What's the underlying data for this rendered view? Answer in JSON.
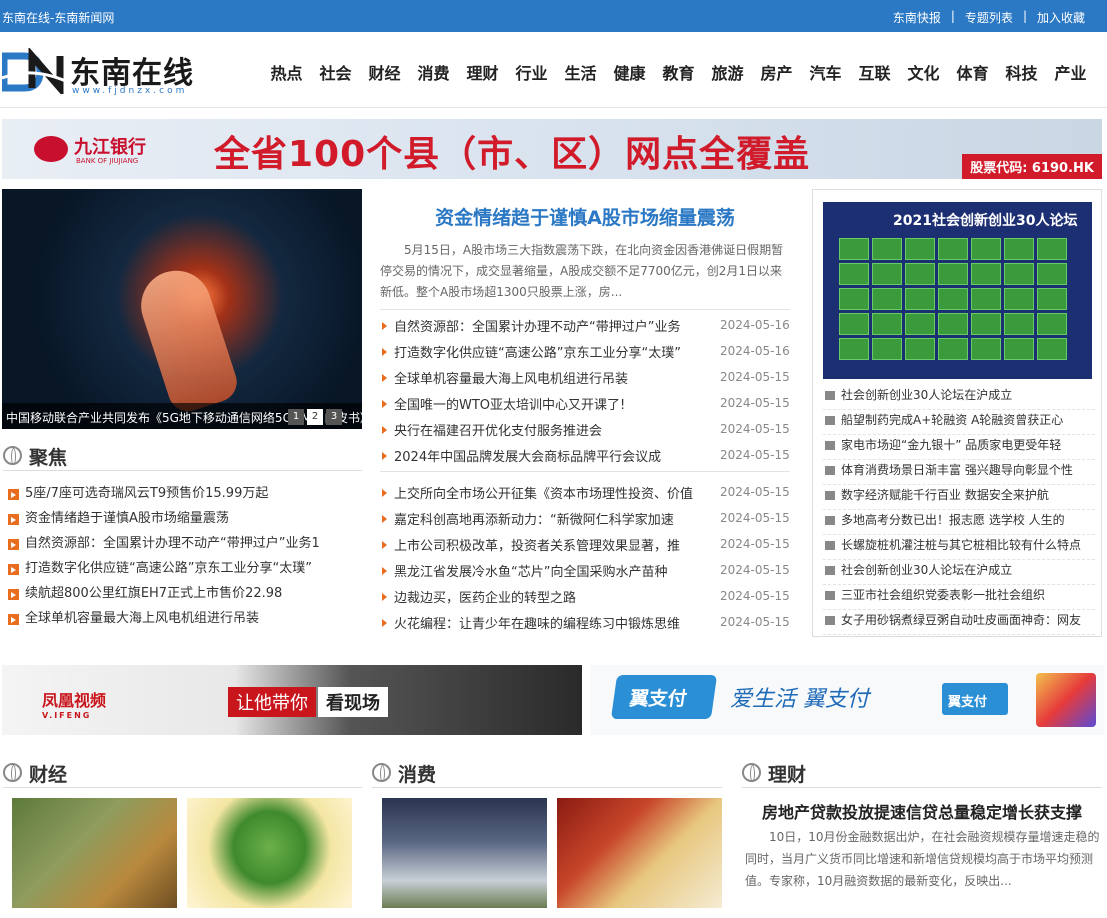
{
  "topbar": {
    "site_title": "东南在线-东南新闻网",
    "links": [
      "东南快报",
      "专题列表",
      "加入收藏"
    ]
  },
  "logo": {
    "name": "东南在线",
    "url": "www.fjdnzx.com"
  },
  "nav": [
    "热点",
    "社会",
    "财经",
    "消费",
    "理财",
    "行业",
    "生活",
    "健康",
    "教育",
    "旅游",
    "房产",
    "汽车",
    "互联",
    "文化",
    "体育",
    "科技",
    "产业"
  ],
  "banner_top": {
    "bank_cn": "九江银行",
    "bank_en": "BANK OF JIUJIANG",
    "slogan": "全省100个县（市、区）网点全覆盖",
    "stock_code": "股票代码: 6190.HK"
  },
  "hero": {
    "caption": "中国移动联合产业共同发布《5G地下移动通信网络5GDMNI白皮书》",
    "pages": [
      "1",
      "2",
      "3"
    ]
  },
  "lead": {
    "title": "资金情绪趋于谨慎A股市场缩量震荡",
    "summary": "5月15日，A股市场三大指数震荡下跌，在北向资金因香港佛诞日假期暂停交易的情况下，成交显著缩量，A股成交额不足7700亿元，创2月1日以来新低。整个A股市场超1300只股票上涨，房..."
  },
  "news_group1": [
    {
      "title": "自然资源部：全国累计办理不动产“带押过户”业务",
      "date": "2024-05-16"
    },
    {
      "title": "打造数字化供应链“高速公路”京东工业分享“太璞”",
      "date": "2024-05-16"
    },
    {
      "title": "全球单机容量最大海上风电机组进行吊装",
      "date": "2024-05-15"
    },
    {
      "title": "全国唯一的WTO亚太培训中心又开课了!",
      "date": "2024-05-15"
    },
    {
      "title": "央行在福建召开优化支付服务推进会",
      "date": "2024-05-15"
    },
    {
      "title": "2024年中国品牌发展大会商标品牌平行会议成",
      "date": "2024-05-15"
    }
  ],
  "news_group2": [
    {
      "title": "上交所向全市场公开征集《资本市场理性投资、价值",
      "date": "2024-05-15"
    },
    {
      "title": "嘉定科创高地再添新动力：“新微阿仁科学家加速",
      "date": "2024-05-15"
    },
    {
      "title": "上市公司积极改革，投资者关系管理效果显著，推",
      "date": "2024-05-15"
    },
    {
      "title": "黑龙江省发展冷水鱼“芯片”向全国采购水产苗种",
      "date": "2024-05-15"
    },
    {
      "title": "边裁边买，医药企业的转型之路",
      "date": "2024-05-15"
    },
    {
      "title": "火花编程：让青少年在趣味的编程练习中锻炼思维",
      "date": "2024-05-15"
    }
  ],
  "side": {
    "pic_title": "2021社会创新创业30人论坛",
    "items": [
      "社会创新创业30人论坛在沪成立",
      "船望制药完成A+轮融资 A轮融资曾获正心",
      "家电市场迎“金九银十” 品质家电更受年轻",
      "体育消费场景日渐丰富 强兴趣导向彰显个性",
      "数字经济赋能千行百业 数据安全来护航",
      "多地高考分数已出！报志愿 选学校 人生的",
      "长螺旋桩机灌注桩与其它桩相比较有什么特点",
      "社会创新创业30人论坛在沪成立",
      "三亚市社会组织党委表彰一批社会组织",
      "女子用砂锅煮绿豆粥自动吐皮画面神奇：网友"
    ]
  },
  "focus": {
    "label": "聚焦",
    "items": [
      "5座/7座可选奇瑞风云T9预售价15.99万起",
      "资金情绪趋于谨慎A股市场缩量震荡",
      "自然资源部：全国累计办理不动产“带押过户”业务1",
      "打造数字化供应链“高速公路”京东工业分享“太璞”",
      "续航超800公里红旗EH7正式上市售价22.98",
      "全球单机容量最大海上风电机组进行吊装"
    ]
  },
  "ad_mid": {
    "brand": "凤凰视频",
    "brand_en": "V.IFENG",
    "tag1": "让他带你",
    "tag2": "看现场",
    "pay_brand": "翼支付",
    "pay_slogan": "爱生活 翼支付",
    "pay_badge": "翼支付"
  },
  "sections": {
    "caijing": "财经",
    "xiaofei": "消费",
    "licai": "理财"
  },
  "licai_article": {
    "title": "房地产贷款投放提速信贷总量稳定增长获支撑",
    "summary": "10日，10月份金融数据出炉，在社会融资规模存量增速走稳的同时，当月广义货币同比增速和新增信贷规模均高于市场平均预测值。专家称，10月融资数据的最新变化，反映出..."
  }
}
